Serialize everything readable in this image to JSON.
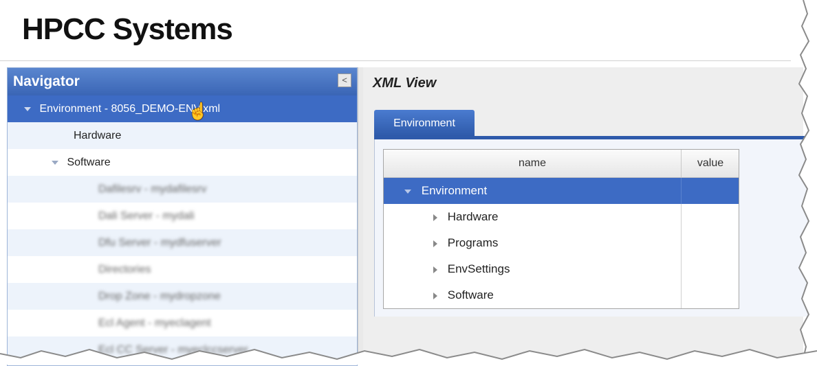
{
  "app": {
    "title": "HPCC Systems"
  },
  "navigator": {
    "title": "Navigator",
    "collapse_glyph": "<",
    "items": [
      {
        "label": "Environment - 8056_DEMO-ENV.xml",
        "level": 0,
        "expanded": true,
        "selected": true
      },
      {
        "label": "Hardware",
        "level": 1
      },
      {
        "label": "Software",
        "level": 1,
        "expanded": true
      },
      {
        "label": "Dafilesrv - mydafilesrv",
        "level": 2,
        "blurred": true
      },
      {
        "label": "Dali Server - mydali",
        "level": 2,
        "blurred": true
      },
      {
        "label": "Dfu Server - mydfuserver",
        "level": 2,
        "blurred": true
      },
      {
        "label": "Directories",
        "level": 2,
        "blurred": true
      },
      {
        "label": "Drop Zone - mydropzone",
        "level": 2,
        "blurred": true
      },
      {
        "label": "Ecl Agent - myeclagent",
        "level": 2,
        "blurred": true
      },
      {
        "label": "Ecl CC Server - myeclccserver",
        "level": 2,
        "blurred": true
      }
    ]
  },
  "xml_view": {
    "title": "XML View",
    "tab_label": "Environment",
    "columns": [
      "name",
      "value"
    ],
    "rows": [
      {
        "name": "Environment",
        "value": "",
        "expanded": true,
        "selected": true
      },
      {
        "name": "Hardware",
        "value": ""
      },
      {
        "name": "Programs",
        "value": ""
      },
      {
        "name": "EnvSettings",
        "value": ""
      },
      {
        "name": "Software",
        "value": ""
      }
    ]
  },
  "colors": {
    "accent": "#3d6bc4",
    "nav_header": "#4a76c4",
    "alt_row": "#edf3fb"
  }
}
